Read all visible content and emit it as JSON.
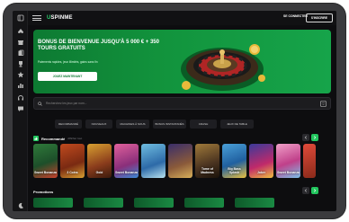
{
  "brand": {
    "prefix": "U",
    "name": "SPINME"
  },
  "header": {
    "login_label": "SE CONNECTER",
    "signup_label": "S'INSCRIRE"
  },
  "banner": {
    "title": "BONUS DE BIENVENUE JUSQU'À 5 000 € + 350 TOURS GRATUITS",
    "subtitle": "Paiements rapides, jeux illimités, gains sans fin",
    "cta_label": "JOUEZ MAINTENANT"
  },
  "search": {
    "placeholder": "Recherchez les jeux par nom..."
  },
  "categories": [
    "RECOMMANDÉ",
    "NOUVEAUX",
    "MACHINES À SOUS",
    "BONUS INSTANTANÉS",
    "CRASH",
    "JEUX DE TABLE"
  ],
  "recommended": {
    "title": "Recommandé",
    "more_label": "Afficher tout",
    "games": [
      {
        "name": "Sweet Bonanza"
      },
      {
        "name": "3 Coins"
      },
      {
        "name": "Gold"
      },
      {
        "name": "Sweet Bonanza"
      },
      {
        "name": ""
      },
      {
        "name": ""
      },
      {
        "name": "Tome of Madness"
      },
      {
        "name": "Big Bass Splash"
      },
      {
        "name": "Joker"
      },
      {
        "name": "Sweet Bonanza"
      },
      {
        "name": ""
      }
    ]
  },
  "promotions": {
    "title": "Promotions"
  },
  "colors": {
    "accent": "#22c55e",
    "banner": "#12943d",
    "background": "#0d0d0f"
  }
}
